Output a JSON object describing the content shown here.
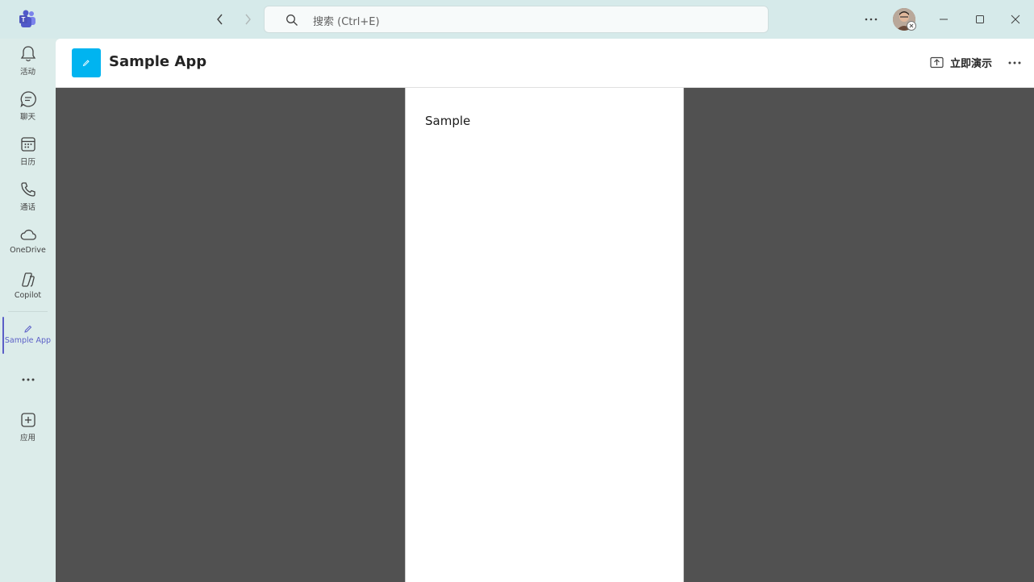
{
  "titlebar": {
    "search_placeholder": "搜索 (Ctrl+E)",
    "back_icon": "chevron-left-icon",
    "forward_icon": "chevron-right-icon"
  },
  "rail": {
    "items": [
      {
        "label": "活动",
        "icon": "bell-icon"
      },
      {
        "label": "聊天",
        "icon": "chat-icon"
      },
      {
        "label": "日历",
        "icon": "calendar-icon"
      },
      {
        "label": "通话",
        "icon": "phone-icon"
      },
      {
        "label": "OneDrive",
        "icon": "cloud-icon"
      },
      {
        "label": "Copilot",
        "icon": "copilot-icon"
      },
      {
        "label": "Sample App",
        "icon": "pencil-icon",
        "active": true
      },
      {
        "label": "应用",
        "icon": "add-square-icon"
      }
    ]
  },
  "header": {
    "app_title": "Sample App",
    "present_label": "立即演示"
  },
  "content": {
    "text": "Sample"
  },
  "colors": {
    "accent": "#5b5fc7",
    "app_icon_bg": "#00b4f0",
    "stage_bg": "#515151",
    "titlebar_bg": "#d6eaea"
  }
}
